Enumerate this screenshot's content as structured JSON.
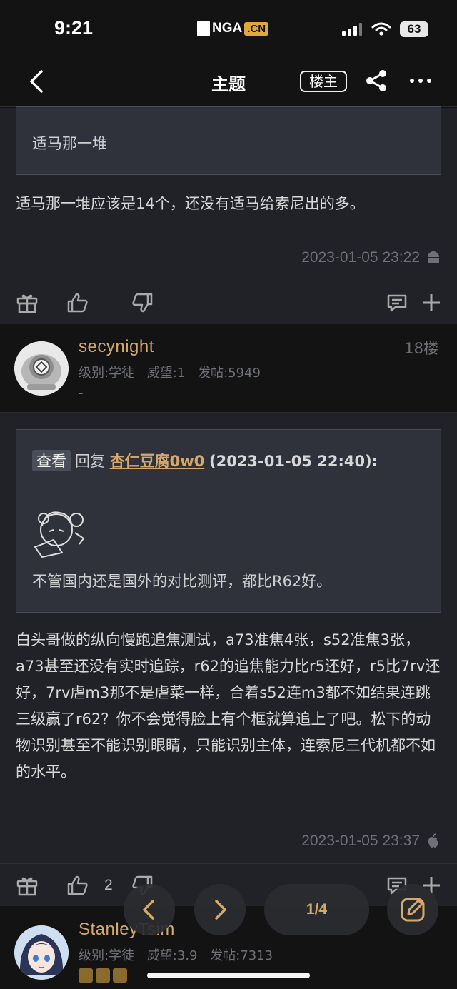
{
  "status_bar": {
    "time": "9:21",
    "app_logo_text": "NGA",
    "app_logo_badge": ".CN",
    "battery": "63"
  },
  "nav": {
    "title": "主题",
    "owner_button": "楼主",
    "icons": [
      "back-icon",
      "share-icon",
      "more-icon"
    ]
  },
  "post17": {
    "quote_text": "适马那一堆",
    "body": "适马那一堆应该是14个，还没有适马给索尼出的多。",
    "timestamp": "2023-01-05 23:22",
    "platform_icon": "android-icon"
  },
  "post18": {
    "username": "secynight",
    "floor": "18楼",
    "level_label": "级别:学徒",
    "prestige_label": "威望:1",
    "posts_label": "发帖:5949",
    "signature": "-",
    "quote": {
      "view_button": "查看",
      "reply_prefix": "回复",
      "reply_user": "杏仁豆腐0w0",
      "reply_time": "(2023-01-05 22:40):",
      "quote_body": "不管国内还是国外的对比测评，都比R62好。"
    },
    "body": "白头哥做的纵向慢跑追焦测试，a73准焦4张，s52准焦3张，a73甚至还没有实时追踪，r62的追焦能力比r5还好，r5比7rv还好，7rv虐m3那不是虐菜一样，合着s52连m3都不如结果连跳三级赢了r62？你不会觉得脸上有个框就算追上了吧。松下的动物识别甚至不能识别眼睛，只能识别主体，连索尼三代机都不如的水平。",
    "timestamp": "2023-01-05 23:37",
    "platform_icon": "apple-icon",
    "like_count": "2"
  },
  "post19": {
    "username": "StanleyTsim",
    "level_label": "级别:学徒",
    "prestige_label": "威望:3.9",
    "posts_label": "发帖:7313"
  },
  "bottom_controls": {
    "page_indicator": "1/4"
  },
  "colors": {
    "accent": "#d7a86b",
    "background": "#131313",
    "post_bg": "#202227",
    "quote_bg": "#2f323a"
  }
}
